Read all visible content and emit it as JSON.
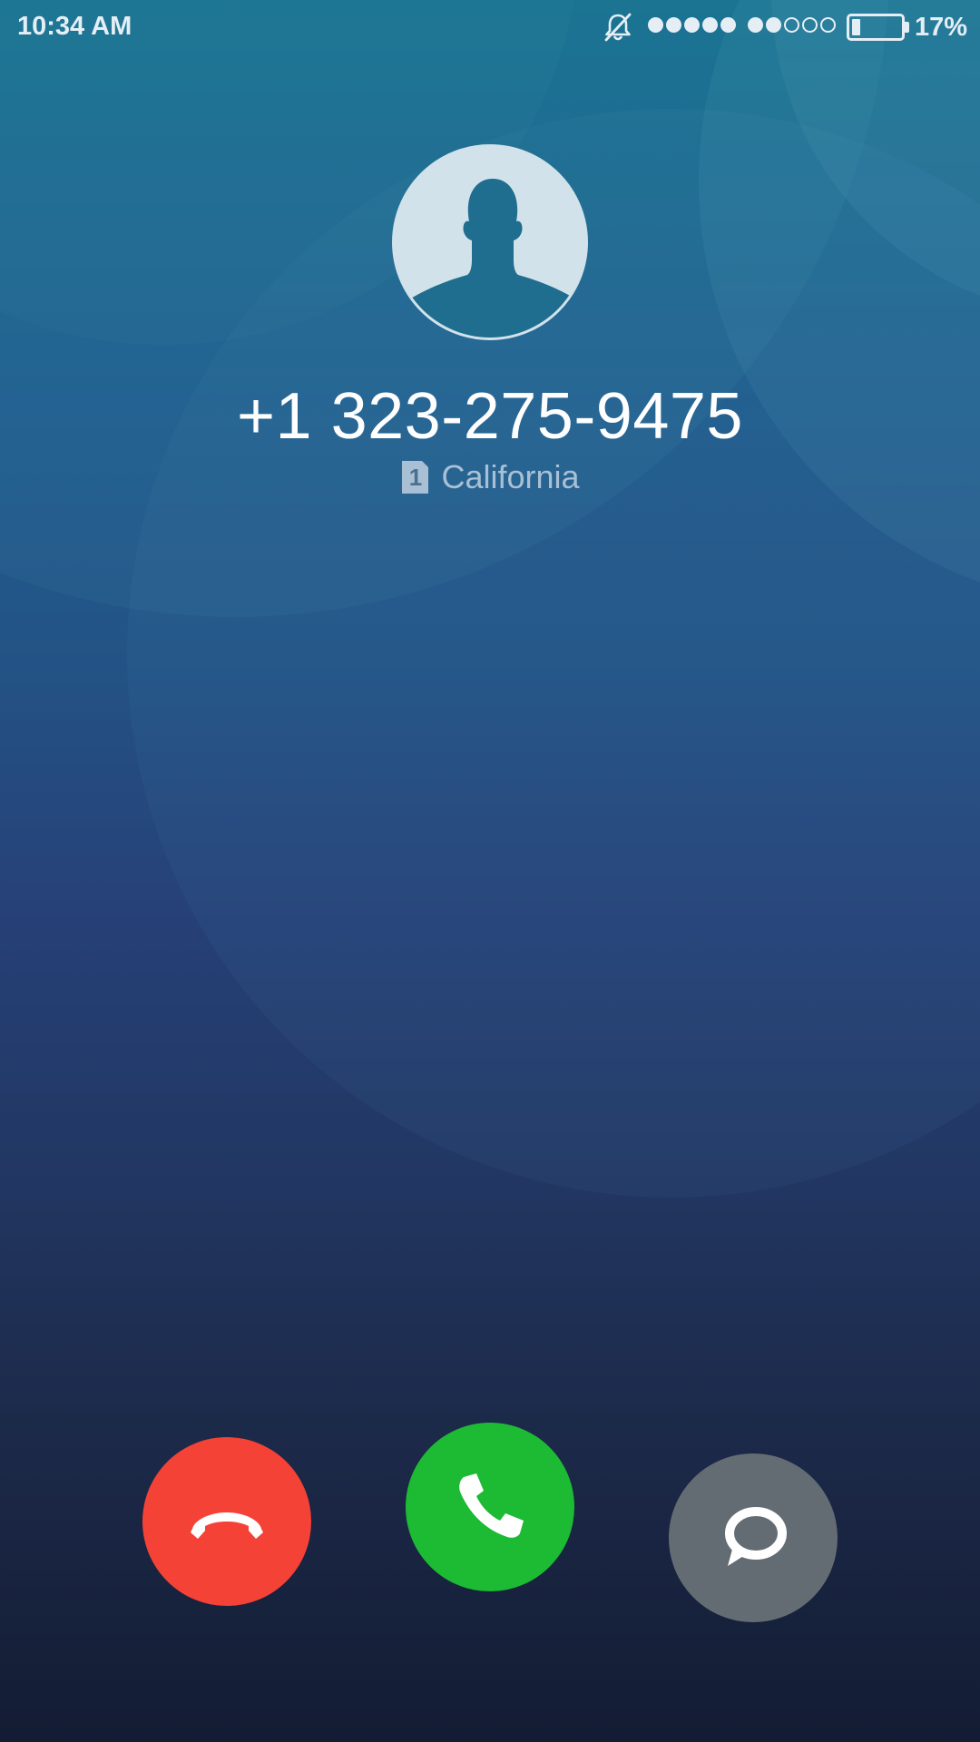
{
  "status_bar": {
    "time": "10:34 AM",
    "bell_icon": "bell-muted-icon",
    "sim1_signal_level": 5,
    "sim2_signal_level": 2,
    "signal_max": 5,
    "battery_level": 0.17,
    "battery_percent": "17%"
  },
  "caller": {
    "avatar_icon": "default-contact-avatar-icon",
    "number": "+1 323-275-9475",
    "sim_icon": "sim-1-icon",
    "sim_label": "1",
    "location": "California"
  },
  "actions": {
    "decline_icon": "phone-hangup-icon",
    "accept_icon": "phone-icon",
    "message_icon": "chat-bubble-icon"
  },
  "colors": {
    "decline": "#f44336",
    "accept": "#1dba33",
    "message": "#646c73"
  }
}
